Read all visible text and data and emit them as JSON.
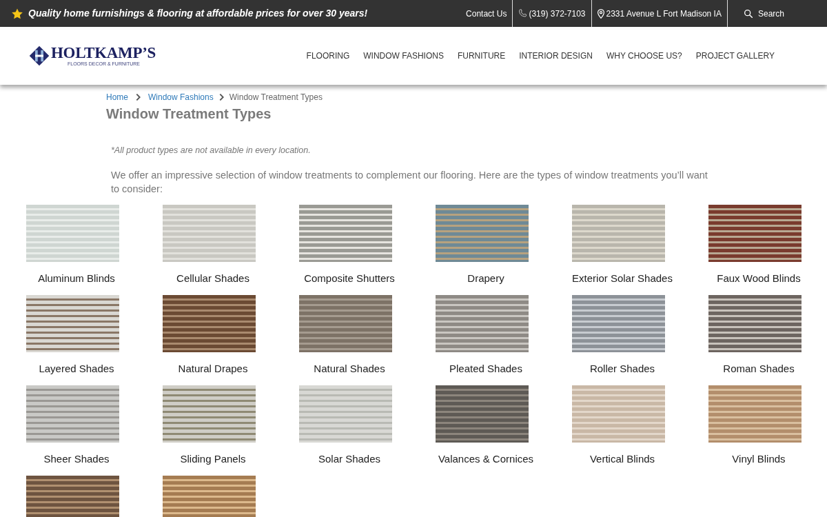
{
  "top_bar": {
    "tagline": "Quality home furnishings & flooring at affordable prices for over 30 years!",
    "links": [
      {
        "kind": "contact",
        "label": "Contact Us"
      },
      {
        "kind": "phone",
        "label": "(319) 372-7103"
      },
      {
        "kind": "address",
        "label": "2331 Avenue L Fort Madison IA"
      },
      {
        "kind": "search",
        "label": "Search"
      }
    ]
  },
  "header": {
    "logo": {
      "name": "HOLTKAMP’S",
      "tagline": "FLOORS DECOR & FURNITURE"
    },
    "nav": [
      "FLOORING",
      "WINDOW FASHIONS",
      "FURNITURE",
      "INTERIOR DESIGN",
      "WHY CHOOSE US?",
      "PROJECT GALLERY"
    ]
  },
  "breadcrumb": [
    {
      "kind": "link",
      "label": "Home"
    },
    {
      "kind": "link",
      "label": "Window Fashions"
    },
    {
      "kind": "current",
      "label": "Window Treatment Types"
    }
  ],
  "page": {
    "title": "Window Treatment Types",
    "note": "*All product types are not available in every location.",
    "intro": "We offer an impressive selection of window treatments to complement our flooring. Here are the types of window treatments you’ll want to consider:"
  },
  "products": [
    {
      "kind": "tile",
      "label": "Aluminum Blinds"
    },
    {
      "kind": "tile",
      "label": "Cellular Shades"
    },
    {
      "kind": "tile",
      "label": "Composite Shutters"
    },
    {
      "kind": "tile",
      "label": "Drapery"
    },
    {
      "kind": "tile",
      "label": "Exterior Solar Shades"
    },
    {
      "kind": "tile",
      "label": "Faux Wood Blinds"
    },
    {
      "kind": "tile",
      "label": "Layered Shades"
    },
    {
      "kind": "tile",
      "label": "Natural Drapes"
    },
    {
      "kind": "tile",
      "label": "Natural Shades"
    },
    {
      "kind": "tile",
      "label": "Pleated Shades"
    },
    {
      "kind": "tile",
      "label": "Roller Shades"
    },
    {
      "kind": "tile",
      "label": "Roman Shades"
    },
    {
      "kind": "tile",
      "label": "Sheer Shades"
    },
    {
      "kind": "tile",
      "label": "Sliding Panels"
    },
    {
      "kind": "tile",
      "label": "Solar Shades"
    },
    {
      "kind": "tile",
      "label": "Valances & Cornices"
    },
    {
      "kind": "tile",
      "label": "Vertical Blinds"
    },
    {
      "kind": "tile",
      "label": "Vinyl Blinds"
    },
    {
      "kind": "photo"
    },
    {
      "kind": "photo"
    }
  ]
}
